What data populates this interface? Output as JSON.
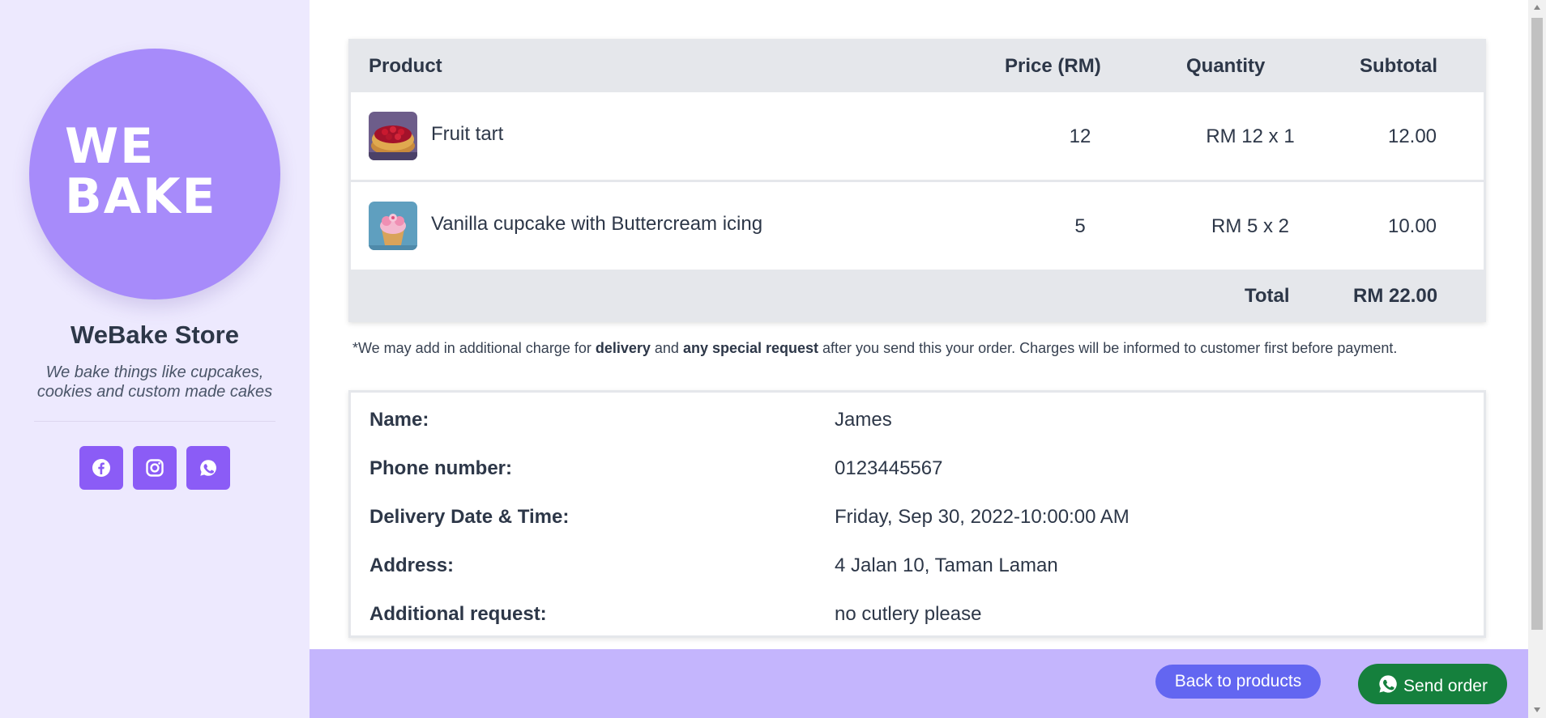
{
  "store": {
    "logo_text_line1": "WE",
    "logo_text_line2": "BAKE",
    "name": "WeBake Store",
    "tagline": "We bake things like cupcakes, cookies and custom made cakes"
  },
  "social": [
    {
      "icon": "facebook-icon"
    },
    {
      "icon": "instagram-icon"
    },
    {
      "icon": "whatsapp-icon"
    }
  ],
  "cart": {
    "headers": {
      "product": "Product",
      "price": "Price (RM)",
      "quantity": "Quantity",
      "subtotal": "Subtotal"
    },
    "items": [
      {
        "name": "Fruit tart",
        "price": "12",
        "quantity": "RM 12 x 1",
        "subtotal": "12.00",
        "thumb": "fruit-tart-image"
      },
      {
        "name": "Vanilla cupcake with Buttercream icing",
        "price": "5",
        "quantity": "RM 5 x 2",
        "subtotal": "10.00",
        "thumb": "cupcake-image"
      }
    ],
    "total_label": "Total",
    "total_value": "RM 22.00"
  },
  "note": {
    "prefix": "*We may add in additional charge for ",
    "bold1": "delivery",
    "mid": " and ",
    "bold2": "any special request",
    "suffix": " after you send this your order. Charges will be informed to customer first before payment."
  },
  "details": [
    {
      "label": "Name:",
      "value": "James"
    },
    {
      "label": "Phone number:",
      "value": "0123445567"
    },
    {
      "label": "Delivery Date & Time:",
      "value": "Friday, Sep 30, 2022-10:00:00 AM"
    },
    {
      "label": "Address:",
      "value": "4 Jalan 10, Taman Laman"
    },
    {
      "label": "Additional request:",
      "value": "no cutlery please"
    }
  ],
  "footer": {
    "back_label": "Back to products",
    "send_label": "Send order"
  },
  "colors": {
    "sidebar_bg": "#ede9fe",
    "logo_bg": "#a78bfa",
    "social_bg": "#8b5cf6",
    "footer_bg": "#c4b5fd",
    "back_button": "#6366f1",
    "send_button": "#15803d"
  }
}
